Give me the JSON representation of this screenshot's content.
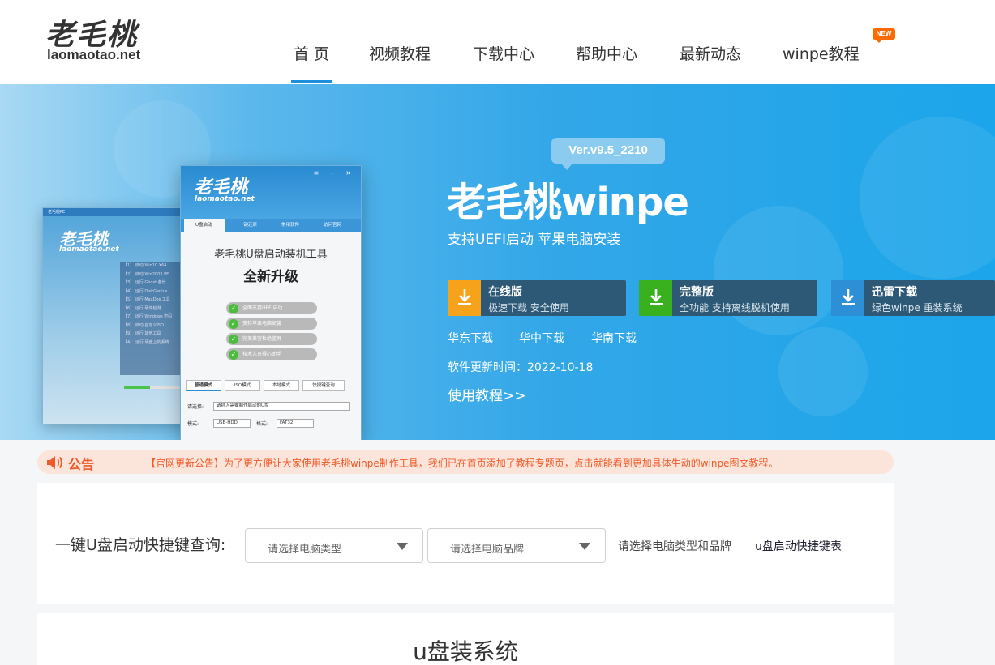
{
  "logo": {
    "cn": "老毛桃",
    "en": "laomaotao.net"
  },
  "nav": {
    "items": [
      {
        "label": "首 页",
        "active": true
      },
      {
        "label": "视频教程"
      },
      {
        "label": "下载中心"
      },
      {
        "label": "帮助中心"
      },
      {
        "label": "最新动态"
      },
      {
        "label": "winpe教程",
        "badge": "NEW"
      }
    ],
    "accent": "#1e8fdc"
  },
  "screenshot": {
    "back": {
      "title": "老毛桃PE",
      "logo_cn": "老毛桃",
      "logo_en": "laomaotao.net",
      "menu": [
        "【1】 启动 Win10 X64",
        "【2】 启动 Win2003 PE",
        "【3】 运行 Ghost 备份",
        "【4】 运行 DiskGenius",
        "【5】 运行 MaxDos 工具",
        "【6】 运行 硬件检测",
        "【7】 运行 Windows 密码",
        "【8】 启动 自定义ISO",
        "【9】 运行 其他工具",
        "【A】 运行 硬盘上的系统"
      ],
      "progress": 0.45
    },
    "front": {
      "logo_cn": "老毛桃",
      "logo_en": "laomaotao.net",
      "controls": "≡ – ×",
      "tabs": [
        "U盘启动",
        "一键还原",
        "常用软件",
        "访问官网"
      ],
      "title": "老毛桃U盘启动装机工具",
      "big": "全新升级",
      "features": [
        "全面支持UEFI启动",
        "支持苹果电脑安装",
        "完美兼容杜绝蓝屏",
        "技术人员得心助手"
      ],
      "modes": [
        "普通模式",
        "ISO模式",
        "本地模式",
        "快捷键查询"
      ],
      "select_label": "请选择:",
      "select_value": "请插入需要制作启动的U盘",
      "mode_label": "模式:",
      "mode_value": "USB-HDD",
      "format_label": "格式:",
      "format_value": "FAT32"
    }
  },
  "hero": {
    "version": "Ver.v9.5_2210",
    "title": "老毛桃winpe",
    "subtitle": "支持UEFI启动 苹果电脑安装",
    "downloads": [
      {
        "name": "在线版",
        "desc": "极速下载 安全使用",
        "color": "#f7a21b"
      },
      {
        "name": "完整版",
        "desc": "全功能 支持离线脱机使用",
        "color": "#39b01d"
      },
      {
        "name": "迅雷下载",
        "desc": "绿色winpe 重装系统",
        "color": "#2d8fd6"
      }
    ],
    "mirrors": [
      "华东下载",
      "华中下载",
      "华南下载"
    ],
    "update_time": "软件更新时间：2022-10-18",
    "tutorial": "使用教程>>"
  },
  "notice": {
    "label": "公告",
    "text": "【官网更新公告】为了更方便让大家使用老毛桃winpe制作工具，我们已在首页添加了教程专题页，点击就能看到更加具体生动的winpe图文教程。"
  },
  "query": {
    "label": "一键U盘启动快捷键查询:",
    "type_placeholder": "请选择电脑类型",
    "brand_placeholder": "请选择电脑品牌",
    "hint": "请选择电脑类型和品牌",
    "link": "u盘启动快捷键表"
  },
  "section": {
    "title": "u盘装系统"
  }
}
